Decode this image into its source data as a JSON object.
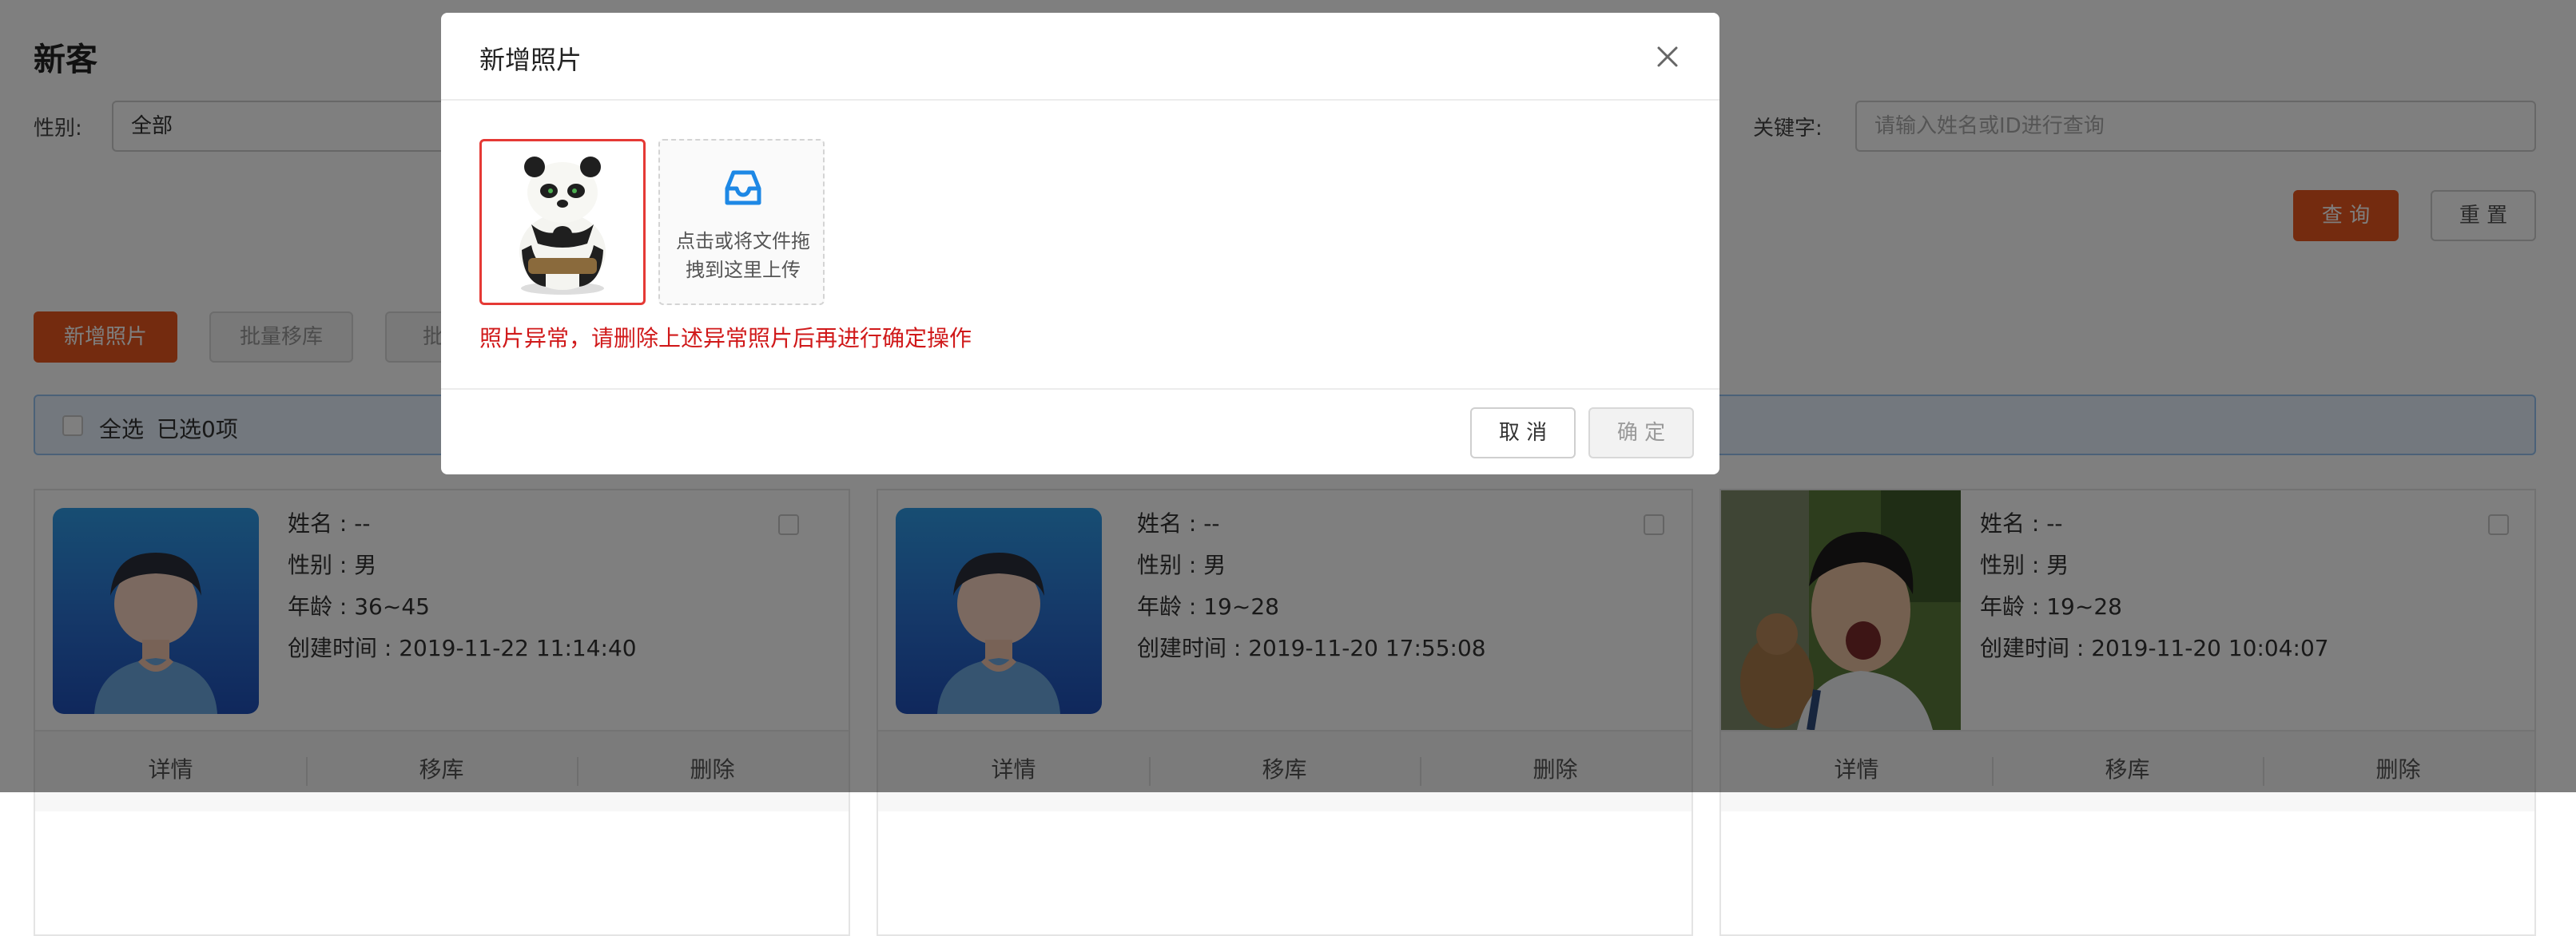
{
  "page": {
    "title": "新客",
    "gender_label": "性别:",
    "gender_value": "全部",
    "keyword_label": "关键字:",
    "keyword_placeholder": "请输入姓名或ID进行查询",
    "query_button": "查 询",
    "reset_button": "重 置",
    "add_photo_button": "新增照片",
    "batch_move_button": "批量移库",
    "third_button_partial": "批",
    "select_all_label": "全选",
    "selected_count": "已选0项"
  },
  "cards": [
    {
      "name": "姓名 : --",
      "gender": "性别 : 男",
      "age": "年龄 : 36~45",
      "created": "创建时间 : 2019-11-22 11:14:40",
      "avatar": "default-male-avatar",
      "actions": [
        "详情",
        "移库",
        "删除"
      ]
    },
    {
      "name": "姓名 : --",
      "gender": "性别 : 男",
      "age": "年龄 : 19~28",
      "created": "创建时间 : 2019-11-20 17:55:08",
      "avatar": "default-male-avatar",
      "actions": [
        "详情",
        "移库",
        "删除"
      ]
    },
    {
      "name": "姓名 : --",
      "gender": "性别 : 男",
      "age": "年龄 : 19~28",
      "created": "创建时间 : 2019-11-20 10:04:07",
      "avatar": "photo-young-man",
      "actions": [
        "详情",
        "移库",
        "删除"
      ]
    }
  ],
  "modal": {
    "title": "新增照片",
    "upload_hint": "点击或将文件拖拽到这里上传",
    "error_message": "照片异常，请删除上述异常照片后再进行确定操作",
    "cancel_button": "取 消",
    "confirm_button": "确 定"
  },
  "colors": {
    "accent": "#e8571e",
    "error": "#d0191a",
    "upload_icon": "#1e88e5",
    "select_bar_bg": "#e6f1fc"
  }
}
